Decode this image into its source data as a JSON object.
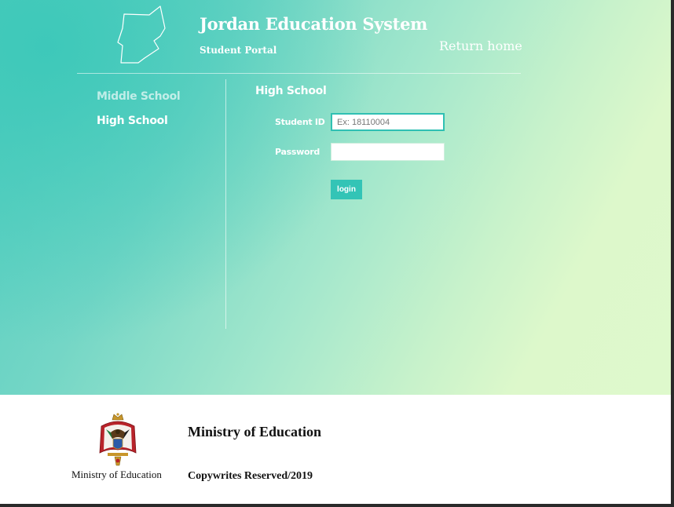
{
  "header": {
    "title": "Jordan Education System",
    "subtitle": "Student Portal",
    "return_home": "Return home",
    "logo_icon": "jordan-map-outline-icon"
  },
  "sidebar": {
    "items": [
      {
        "label": "Middle School",
        "active": false
      },
      {
        "label": "High School",
        "active": true
      }
    ]
  },
  "login_form": {
    "title": "High School",
    "student_id_label": "Student ID",
    "student_id_placeholder": "Ex: 18110004",
    "student_id_value": "",
    "password_label": "Password",
    "password_value": "",
    "login_label": "login"
  },
  "footer": {
    "emblem_icon": "coat-of-arms-icon",
    "emblem_caption": "Ministry of Education",
    "org_name": "Ministry of Education",
    "copyright": "Copywrites Reserved/2019"
  },
  "colors": {
    "accent": "#33c4b6",
    "gradient_start": "#3cc8b9",
    "gradient_end": "#def9cc"
  }
}
